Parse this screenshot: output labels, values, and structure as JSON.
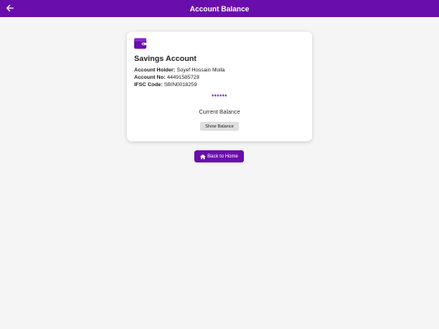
{
  "header": {
    "title": "Account Balance",
    "back_icon": "arrow-left-icon"
  },
  "account": {
    "icon": "wallet-icon",
    "type": "Savings Account",
    "holder_label": "Account Holder:",
    "holder_value": "Soyef Hossain Molla",
    "number_label": "Account No:",
    "number_value": "44491585729",
    "ifsc_label": "IFSC Code:",
    "ifsc_value": "SBIN0018259",
    "masked_balance": "******",
    "balance_label": "Current Balance",
    "show_button_label": "Show Balance"
  },
  "footer": {
    "home_icon": "home-icon",
    "home_button_label": "Back to Home"
  },
  "colors": {
    "accent": "#6a0dad",
    "background": "#f5f5f5",
    "card": "#ffffff",
    "button_gray": "#e0e0e0"
  }
}
